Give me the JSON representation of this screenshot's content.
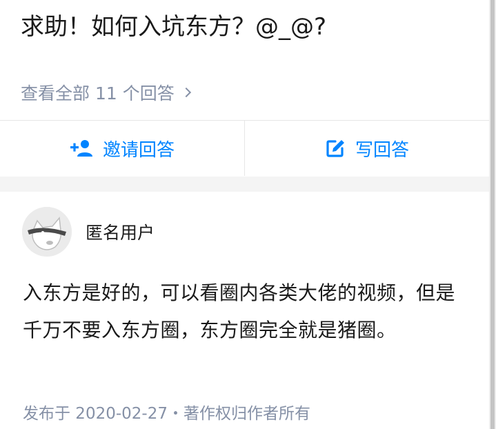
{
  "question": {
    "title": "求助！如何入坑东方？@_@?",
    "view_all": "查看全部 11 个回答"
  },
  "actions": {
    "invite_label": "邀请回答",
    "write_label": "写回答"
  },
  "answer": {
    "author_name": "匿名用户",
    "content": "入东方是好的，可以看圈内各类大佬的视频，但是千万不要入东方圈，东方圈完全就是猪圈。",
    "meta": "发布于 2020-02-27・著作权归作者所有"
  },
  "colors": {
    "accent": "#0084ff",
    "muted": "#8590a6",
    "text": "#1a1a1a",
    "divider": "#e6e6e6",
    "section_gap": "#f4f4f4"
  },
  "icons": {
    "invite": "add-person-icon",
    "write": "edit-icon",
    "view_all": "chevron-right-icon"
  }
}
